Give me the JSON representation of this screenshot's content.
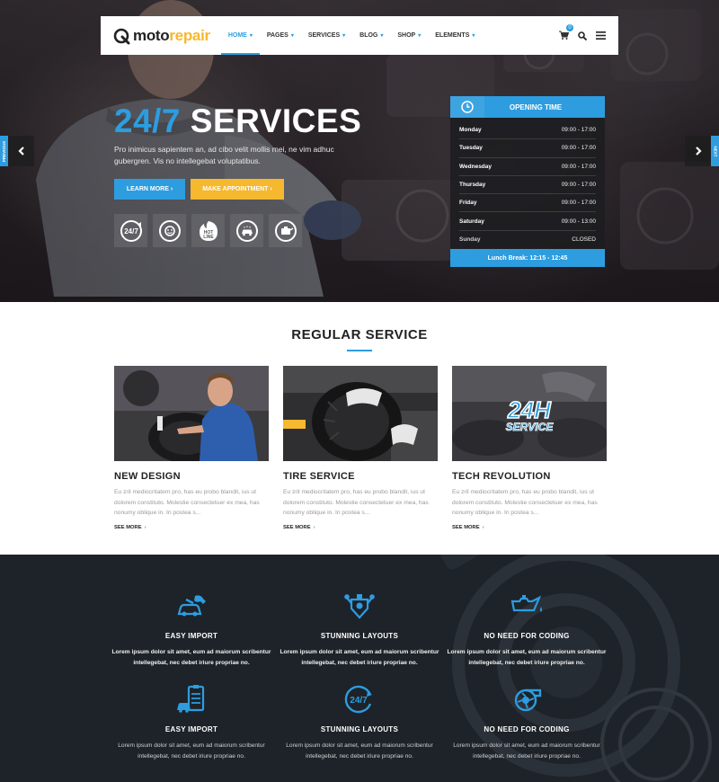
{
  "header": {
    "logo": {
      "part1": "moto",
      "part2": "repair"
    },
    "nav": [
      {
        "label": "HOME",
        "active": true
      },
      {
        "label": "PAGES",
        "active": false
      },
      {
        "label": "SERVICES",
        "active": false
      },
      {
        "label": "BLOG",
        "active": false
      },
      {
        "label": "SHOP",
        "active": false
      },
      {
        "label": "ELEMENTS",
        "active": false
      }
    ],
    "cart_count": "0",
    "icons": [
      "cart-icon",
      "search-icon",
      "menu-icon"
    ]
  },
  "slider": {
    "prev_label": "PREVIOUS",
    "next_label": "NEXT"
  },
  "hero": {
    "title_accent": "24/7",
    "title_main": "SERVICES",
    "description": "Pro inimicus sapientem an, ad cibo velit mollis mei, ne vim adhuc gubergren. Vis no intellegebat voluptatibus.",
    "learn_more": "LEARN MORE",
    "appointment": "MAKE APPOINTMENT",
    "badges": [
      "24-7-icon",
      "smile-care-icon",
      "hotline-icon",
      "car-wash-icon",
      "oil-change-icon"
    ],
    "badge_texts": {
      "b1": "24/7",
      "b3_top": "HOT",
      "b3_bottom": "LINE"
    }
  },
  "opening": {
    "title": "OPENING TIME",
    "rows": [
      {
        "day": "Monday",
        "time": "09:00 - 17:00"
      },
      {
        "day": "Tuesday",
        "time": "09:00 - 17:00"
      },
      {
        "day": "Wednesday",
        "time": "09:00 - 17:00"
      },
      {
        "day": "Thursday",
        "time": "09:00 - 17:00"
      },
      {
        "day": "Friday",
        "time": "09:00 - 17:00"
      },
      {
        "day": "Saturday",
        "time": "09:00 - 13:00"
      },
      {
        "day": "Sunday",
        "time": "CLOSED"
      }
    ],
    "lunch": "Lunch Break: 12:15 - 12:45"
  },
  "services": {
    "title": "REGULAR SERVICE",
    "items": [
      {
        "name": "NEW DESIGN",
        "text": "Eu zril mediocritatem pro, has eu probo blandit, ius ut dolorem constituto. Molestie consectetuer ex mea, has nonumy oblique in. In postea s...",
        "more": "SEE MORE"
      },
      {
        "name": "TIRE SERVICE",
        "text": "Eu zril mediocritatem pro, has eu probo blandit, ius ut dolorem constituto. Molestie consectetuer ex mea, has nonumy oblique in. In postea s...",
        "more": "SEE MORE"
      },
      {
        "name": "TECH REVOLUTION",
        "text": "Eu zril mediocritatem pro, has eu probo blandit, ius ut dolorem constituto. Molestie consectetuer ex mea, has nonumy oblique in. In postea s...",
        "more": "SEE MORE"
      }
    ],
    "badge_24h": {
      "top": "24H",
      "bottom": "SERVICE"
    }
  },
  "features": [
    {
      "icon": "car-wrench-icon",
      "title": "EASY IMPORT",
      "text": "Lorem ipsum dolor sit amet, eum ad maiorum scribentur intellegebat, nec debet iriure propriae no."
    },
    {
      "icon": "engine-icon",
      "title": "STUNNING LAYOUTS",
      "text": "Lorem ipsum dolor sit amet, eum ad maiorum scribentur intellegebat, nec debet iriure propriae no."
    },
    {
      "icon": "oil-can-icon",
      "title": "NO NEED FOR CODING",
      "text": "Lorem ipsum dolor sit amet, eum ad maiorum scribentur intellegebat, nec debet iriure propriae no."
    },
    {
      "icon": "car-checklist-icon",
      "title": "EASY IMPORT",
      "text": "Lorem ipsum dolor sit amet, eum ad maiorum scribentur intellegebat, nec debet iriure propriae no."
    },
    {
      "icon": "24-7-service-icon",
      "title": "STUNNING LAYOUTS",
      "text": "Lorem ipsum dolor sit amet, eum ad maiorum scribentur intellegebat, nec debet iriure propriae no.",
      "icon_text": "24/7"
    },
    {
      "icon": "turbo-icon",
      "title": "NO NEED FOR CODING",
      "text": "Lorem ipsum dolor sit amet, eum ad maiorum scribentur intellegebat, nec debet iriure propriae no."
    }
  ],
  "colors": {
    "accent": "#2d9de0",
    "yellow": "#f5b82e",
    "dark": "#1e2329"
  }
}
